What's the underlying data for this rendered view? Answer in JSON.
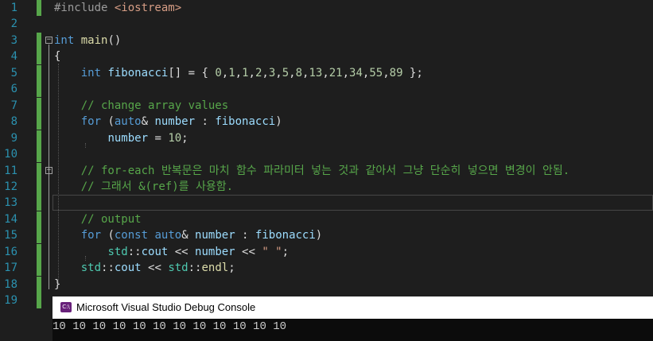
{
  "editor": {
    "lines": [
      {
        "n": "1",
        "parts": [
          [
            "pp",
            "#include "
          ],
          [
            "inc",
            "<iostream>"
          ]
        ]
      },
      {
        "n": "2",
        "parts": []
      },
      {
        "n": "3",
        "parts": [
          [
            "kw",
            "int"
          ],
          [
            "tx",
            " "
          ],
          [
            "fn",
            "main"
          ],
          [
            "tx",
            "()"
          ]
        ]
      },
      {
        "n": "4",
        "parts": [
          [
            "tx",
            "{"
          ]
        ]
      },
      {
        "n": "5",
        "parts": [
          [
            "tx",
            "    "
          ],
          [
            "kw",
            "int"
          ],
          [
            "tx",
            " "
          ],
          [
            "id",
            "fibonacci"
          ],
          [
            "tx",
            "[] = { "
          ],
          [
            "num",
            "0"
          ],
          [
            "tx",
            ","
          ],
          [
            "num",
            "1"
          ],
          [
            "tx",
            ","
          ],
          [
            "num",
            "1"
          ],
          [
            "tx",
            ","
          ],
          [
            "num",
            "2"
          ],
          [
            "tx",
            ","
          ],
          [
            "num",
            "3"
          ],
          [
            "tx",
            ","
          ],
          [
            "num",
            "5"
          ],
          [
            "tx",
            ","
          ],
          [
            "num",
            "8"
          ],
          [
            "tx",
            ","
          ],
          [
            "num",
            "13"
          ],
          [
            "tx",
            ","
          ],
          [
            "num",
            "21"
          ],
          [
            "tx",
            ","
          ],
          [
            "num",
            "34"
          ],
          [
            "tx",
            ","
          ],
          [
            "num",
            "55"
          ],
          [
            "tx",
            ","
          ],
          [
            "num",
            "89"
          ],
          [
            "tx",
            " };"
          ]
        ]
      },
      {
        "n": "6",
        "parts": []
      },
      {
        "n": "7",
        "parts": [
          [
            "tx",
            "    "
          ],
          [
            "cm",
            "// change array values"
          ]
        ]
      },
      {
        "n": "8",
        "parts": [
          [
            "tx",
            "    "
          ],
          [
            "kw",
            "for"
          ],
          [
            "tx",
            " ("
          ],
          [
            "kw",
            "auto"
          ],
          [
            "tx",
            "& "
          ],
          [
            "id",
            "number"
          ],
          [
            "tx",
            " : "
          ],
          [
            "id",
            "fibonacci"
          ],
          [
            "tx",
            ")"
          ]
        ]
      },
      {
        "n": "9",
        "parts": [
          [
            "tx",
            "        "
          ],
          [
            "id",
            "number"
          ],
          [
            "tx",
            " = "
          ],
          [
            "num",
            "10"
          ],
          [
            "tx",
            ";"
          ]
        ]
      },
      {
        "n": "10",
        "parts": []
      },
      {
        "n": "11",
        "parts": [
          [
            "tx",
            "    "
          ],
          [
            "cm",
            "// for-each 반복문은 마치 함수 파라미터 넣는 것과 같아서 그냥 단순히 넣으면 변경이 안됨."
          ]
        ]
      },
      {
        "n": "12",
        "parts": [
          [
            "tx",
            "    "
          ],
          [
            "cm",
            "// 그래서 &(ref)를 사용함."
          ]
        ]
      },
      {
        "n": "13",
        "parts": []
      },
      {
        "n": "14",
        "parts": [
          [
            "tx",
            "    "
          ],
          [
            "cm",
            "// output"
          ]
        ]
      },
      {
        "n": "15",
        "parts": [
          [
            "tx",
            "    "
          ],
          [
            "kw",
            "for"
          ],
          [
            "tx",
            " ("
          ],
          [
            "kw",
            "const"
          ],
          [
            "tx",
            " "
          ],
          [
            "kw",
            "auto"
          ],
          [
            "tx",
            "& "
          ],
          [
            "id",
            "number"
          ],
          [
            "tx",
            " : "
          ],
          [
            "id",
            "fibonacci"
          ],
          [
            "tx",
            ")"
          ]
        ]
      },
      {
        "n": "16",
        "parts": [
          [
            "tx",
            "        "
          ],
          [
            "ty",
            "std"
          ],
          [
            "tx",
            "::"
          ],
          [
            "id",
            "cout"
          ],
          [
            "tx",
            " << "
          ],
          [
            "id",
            "number"
          ],
          [
            "tx",
            " << "
          ],
          [
            "str",
            "\" \""
          ],
          [
            "tx",
            ";"
          ]
        ]
      },
      {
        "n": "17",
        "parts": [
          [
            "tx",
            "    "
          ],
          [
            "ty",
            "std"
          ],
          [
            "tx",
            "::"
          ],
          [
            "id",
            "cout"
          ],
          [
            "tx",
            " << "
          ],
          [
            "ty",
            "std"
          ],
          [
            "tx",
            "::"
          ],
          [
            "fn",
            "endl"
          ],
          [
            "tx",
            ";"
          ]
        ]
      },
      {
        "n": "18",
        "parts": [
          [
            "tx",
            "}"
          ]
        ]
      },
      {
        "n": "19",
        "parts": []
      }
    ]
  },
  "colors": {
    "background": "#1e1e1e",
    "line_number": "#2b91af",
    "change_marker": "#57a64a",
    "keyword": "#569cd6",
    "comment": "#57a64a"
  },
  "console": {
    "icon_label": "C:\\",
    "title": "Microsoft Visual Studio Debug Console",
    "output": "10 10 10 10 10 10 10 10 10 10 10 10"
  }
}
